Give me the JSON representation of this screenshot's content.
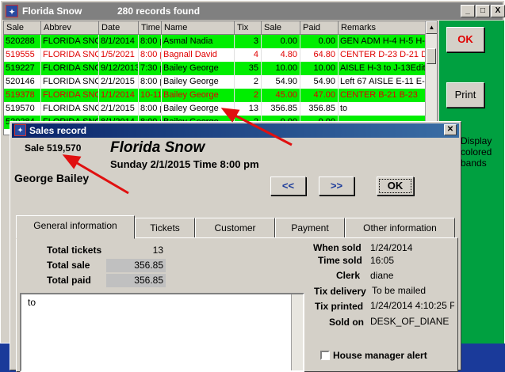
{
  "main_window": {
    "title": "Florida Snow",
    "record_count": "280 records found",
    "controls": [
      "_",
      "□",
      "X"
    ]
  },
  "grid": {
    "columns": [
      "Sale",
      "Abbrev",
      "Date",
      "Time",
      "Name",
      "Tix",
      "Sale",
      "Paid",
      "Remarks"
    ],
    "rows": [
      {
        "sale": "520288",
        "abbrev": "FLORIDA SNOW",
        "date": "8/1/2014",
        "time": "8:00 pm",
        "name": "Asmal Nadia",
        "tix": "3",
        "amount": "0.00",
        "paid": "0.00",
        "remarks": "GEN ADM H-4 H-5 H-6",
        "bg": "#00ee00",
        "fg": "#000000"
      },
      {
        "sale": "519555",
        "abbrev": "FLORIDA SNOW",
        "date": "1/5/2021",
        "time": "8:00 pm",
        "name": "Bagnall David",
        "tix": "4",
        "amount": "4.80",
        "paid": "64.80",
        "remarks": "CENTER D-23 D-21 D-2",
        "bg": "#ffffff",
        "fg": "#e00000"
      },
      {
        "sale": "519227",
        "abbrev": "FLORIDA SNOW",
        "date": "9/12/2013",
        "time": "7:30 pm",
        "name": "Bailey George",
        "tix": "35",
        "amount": "10.00",
        "paid": "10.00",
        "remarks": "AISLE H-3 to J-13Edite",
        "bg": "#00ee00",
        "fg": "#000000"
      },
      {
        "sale": "520146",
        "abbrev": "FLORIDA SNOW",
        "date": "2/1/2015",
        "time": "8:00 pm",
        "name": "Bailey George",
        "tix": "2",
        "amount": "54.90",
        "paid": "54.90",
        "remarks": "Left 67 AISLE E-11 E-1",
        "bg": "#ffffff",
        "fg": "#000000"
      },
      {
        "sale": "519378",
        "abbrev": "FLORIDA SNOW",
        "date": "1/1/2014",
        "time": "10-11",
        "name": "Bailey George",
        "tix": "2",
        "amount": "45.00",
        "paid": "47.00",
        "remarks": "CENTER B-21 B-23",
        "bg": "#00ee00",
        "fg": "#e00000"
      },
      {
        "sale": "519570",
        "abbrev": "FLORIDA SNOW",
        "date": "2/1/2015",
        "time": "8:00 pm",
        "name": "Bailey George",
        "tix": "13",
        "amount": "356.85",
        "paid": "356.85",
        "remarks": "to",
        "bg": "#ffffff",
        "fg": "#000000"
      },
      {
        "sale": "520284",
        "abbrev": "FLORIDA SNOW",
        "date": "8/1/2014",
        "time": "8:00 pm",
        "name": "Bailey George",
        "tix": "2",
        "amount": "0.00",
        "paid": "0.00",
        "remarks": "",
        "bg": "#00ee00",
        "fg": "#000000"
      }
    ]
  },
  "right_panel": {
    "ok_label": "OK",
    "print_label": "Print",
    "legend_text": "Display colored bands"
  },
  "dialog": {
    "title": "Sales record",
    "sale_number": "Sale 519,570",
    "event_name": "Florida Snow",
    "event_datetime": "Sunday 2/1/2015  Time 8:00 pm",
    "customer_name": "George Bailey",
    "prev_label": "<<",
    "next_label": ">>",
    "ok_label": "OK",
    "tabs": [
      "General information",
      "Tickets",
      "Customer",
      "Payment",
      "Other information"
    ],
    "general": {
      "total_tickets_label": "Total tickets",
      "total_tickets": "13",
      "total_sale_label": "Total sale",
      "total_sale": "356.85",
      "total_paid_label": "Total paid",
      "total_paid": "356.85",
      "remarks_text": "to",
      "when_sold_label": "When sold",
      "when_sold": "1/24/2014",
      "time_sold_label": "Time sold",
      "time_sold": "16:05",
      "clerk_label": "Clerk",
      "clerk": "diane",
      "tix_delivery_label": "Tix delivery",
      "tix_delivery": "To be mailed",
      "tix_printed_label": "Tix printed",
      "tix_printed": "1/24/2014 4:10:25 P",
      "sold_on_label": "Sold on",
      "sold_on": "DESK_OF_DIANE",
      "house_manager_label": "House manager alert"
    }
  },
  "colors": {
    "row_green": "#00ee00",
    "panel_green": "#00a040",
    "desktop": "#1a3a9a",
    "arrow_red": "#e01010"
  }
}
